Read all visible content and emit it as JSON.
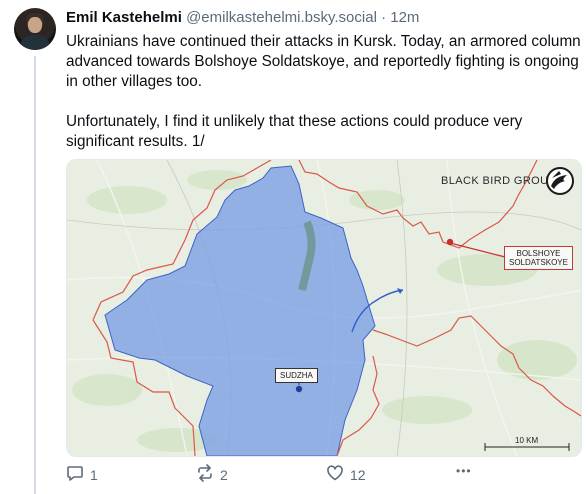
{
  "post": {
    "author": "Emil Kastehelmi",
    "handle": "@emilkastehelmi.bsky.social",
    "separator": "·",
    "time": "12m",
    "paragraph_1": "Ukrainians have continued their attacks in Kursk. Today, an armored column advanced towards Bolshoye Soldatskoye, and reportedly fighting is ongoing in other villages too.",
    "paragraph_2": "Unfortunately, I find it unlikely that these actions could produce very significant results. 1/"
  },
  "map": {
    "brand": "BLACK BIRD GROUP",
    "label_soldatskoye_line1": "BOLSHOYE",
    "label_soldatskoye_line2": "SOLDATSKOYE",
    "label_sudzha": "SUDZHA",
    "scale": "10 KM",
    "colors": {
      "controlled_area": "#7b9fe6",
      "border": "#d9584b",
      "marker_red": "#c9302c",
      "marker_blue": "#1f3f9a"
    }
  },
  "actions": {
    "replies": "1",
    "reposts": "2",
    "likes": "12",
    "more": "•••"
  },
  "icons": {
    "reply": "reply-icon",
    "repost": "repost-icon",
    "like": "heart-icon",
    "more": "more-icon",
    "logo": "black-bird-logo-icon"
  }
}
